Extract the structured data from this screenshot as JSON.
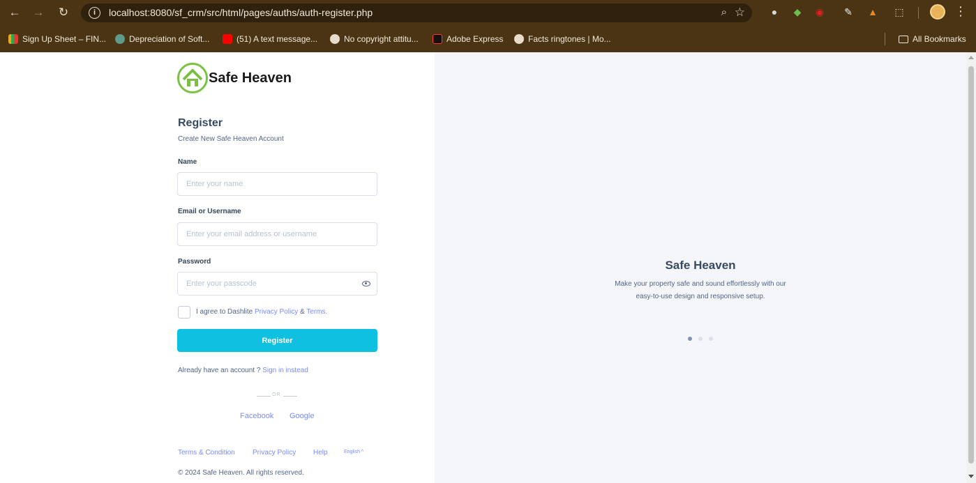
{
  "browser": {
    "url": "localhost:8080/sf_crm/src/html/pages/auths/auth-register.php",
    "bookmarks": [
      {
        "label": "Sign Up Sheet – FIN...",
        "color": "#f4a31b"
      },
      {
        "label": "Depreciation of Soft...",
        "color": "#5f9b8c"
      },
      {
        "label": "(51) A text message...",
        "color": "#ff0000"
      },
      {
        "label": "No copyright attitu...",
        "color": "#e8dccb"
      },
      {
        "label": "Adobe Express",
        "color": "#1a0f0f"
      },
      {
        "label": "Facts ringtones | Mo...",
        "color": "#e8dccb"
      }
    ],
    "all_bookmarks": "All Bookmarks"
  },
  "brand": {
    "name": "Safe Heaven",
    "green": "#7ac043",
    "accent": "#0fc0e0",
    "link": "#798bff"
  },
  "form": {
    "title": "Register",
    "subtitle": "Create New Safe Heaven Account",
    "name_label": "Name",
    "name_placeholder": "Enter your name",
    "email_label": "Email or Username",
    "email_placeholder": "Enter your email address or username",
    "password_label": "Password",
    "password_placeholder": "Enter your passcode",
    "agree_prefix": "I agree to Dashlite",
    "privacy_link": "Privacy Policy",
    "amp": "&",
    "terms_link": "Terms.",
    "register_button": "Register",
    "already_text": "Already have an account ?",
    "signin_link": "Sign in instead",
    "or_text": "OR",
    "facebook": "Facebook",
    "google": "Google"
  },
  "footer": {
    "terms": "Terms & Condition",
    "privacy": "Privacy Policy",
    "help": "Help",
    "language": "English ^",
    "copyright": "© 2024 Safe Heaven. All rights reserved."
  },
  "promo": {
    "title": "Safe Heaven",
    "line1": "Make your property safe and sound effortlessly with our",
    "line2": "easy-to-use design and responsive setup.",
    "active_slide": 1,
    "slide_count": 3
  }
}
